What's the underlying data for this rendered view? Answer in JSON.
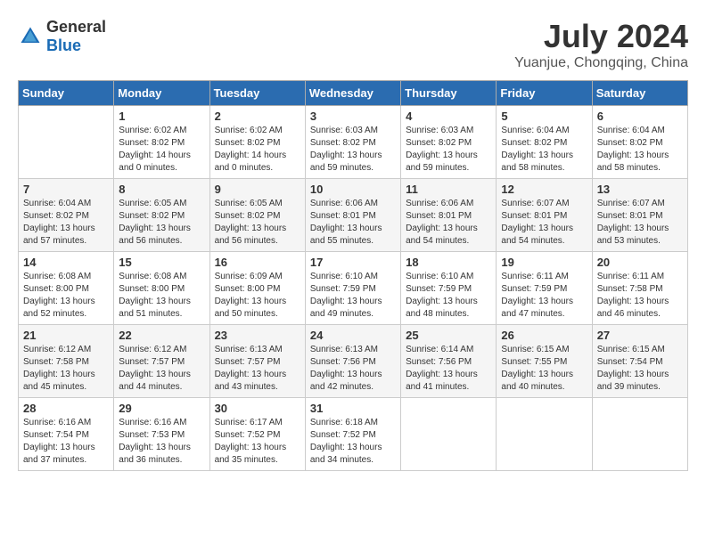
{
  "header": {
    "logo": {
      "general": "General",
      "blue": "Blue"
    },
    "title": "July 2024",
    "location": "Yuanjue, Chongqing, China"
  },
  "columns": [
    "Sunday",
    "Monday",
    "Tuesday",
    "Wednesday",
    "Thursday",
    "Friday",
    "Saturday"
  ],
  "weeks": [
    [
      {
        "day": "",
        "sunrise": "",
        "sunset": "",
        "daylight": ""
      },
      {
        "day": "1",
        "sunrise": "Sunrise: 6:02 AM",
        "sunset": "Sunset: 8:02 PM",
        "daylight": "Daylight: 14 hours and 0 minutes."
      },
      {
        "day": "2",
        "sunrise": "Sunrise: 6:02 AM",
        "sunset": "Sunset: 8:02 PM",
        "daylight": "Daylight: 14 hours and 0 minutes."
      },
      {
        "day": "3",
        "sunrise": "Sunrise: 6:03 AM",
        "sunset": "Sunset: 8:02 PM",
        "daylight": "Daylight: 13 hours and 59 minutes."
      },
      {
        "day": "4",
        "sunrise": "Sunrise: 6:03 AM",
        "sunset": "Sunset: 8:02 PM",
        "daylight": "Daylight: 13 hours and 59 minutes."
      },
      {
        "day": "5",
        "sunrise": "Sunrise: 6:04 AM",
        "sunset": "Sunset: 8:02 PM",
        "daylight": "Daylight: 13 hours and 58 minutes."
      },
      {
        "day": "6",
        "sunrise": "Sunrise: 6:04 AM",
        "sunset": "Sunset: 8:02 PM",
        "daylight": "Daylight: 13 hours and 58 minutes."
      }
    ],
    [
      {
        "day": "7",
        "sunrise": "Sunrise: 6:04 AM",
        "sunset": "Sunset: 8:02 PM",
        "daylight": "Daylight: 13 hours and 57 minutes."
      },
      {
        "day": "8",
        "sunrise": "Sunrise: 6:05 AM",
        "sunset": "Sunset: 8:02 PM",
        "daylight": "Daylight: 13 hours and 56 minutes."
      },
      {
        "day": "9",
        "sunrise": "Sunrise: 6:05 AM",
        "sunset": "Sunset: 8:02 PM",
        "daylight": "Daylight: 13 hours and 56 minutes."
      },
      {
        "day": "10",
        "sunrise": "Sunrise: 6:06 AM",
        "sunset": "Sunset: 8:01 PM",
        "daylight": "Daylight: 13 hours and 55 minutes."
      },
      {
        "day": "11",
        "sunrise": "Sunrise: 6:06 AM",
        "sunset": "Sunset: 8:01 PM",
        "daylight": "Daylight: 13 hours and 54 minutes."
      },
      {
        "day": "12",
        "sunrise": "Sunrise: 6:07 AM",
        "sunset": "Sunset: 8:01 PM",
        "daylight": "Daylight: 13 hours and 54 minutes."
      },
      {
        "day": "13",
        "sunrise": "Sunrise: 6:07 AM",
        "sunset": "Sunset: 8:01 PM",
        "daylight": "Daylight: 13 hours and 53 minutes."
      }
    ],
    [
      {
        "day": "14",
        "sunrise": "Sunrise: 6:08 AM",
        "sunset": "Sunset: 8:00 PM",
        "daylight": "Daylight: 13 hours and 52 minutes."
      },
      {
        "day": "15",
        "sunrise": "Sunrise: 6:08 AM",
        "sunset": "Sunset: 8:00 PM",
        "daylight": "Daylight: 13 hours and 51 minutes."
      },
      {
        "day": "16",
        "sunrise": "Sunrise: 6:09 AM",
        "sunset": "Sunset: 8:00 PM",
        "daylight": "Daylight: 13 hours and 50 minutes."
      },
      {
        "day": "17",
        "sunrise": "Sunrise: 6:10 AM",
        "sunset": "Sunset: 7:59 PM",
        "daylight": "Daylight: 13 hours and 49 minutes."
      },
      {
        "day": "18",
        "sunrise": "Sunrise: 6:10 AM",
        "sunset": "Sunset: 7:59 PM",
        "daylight": "Daylight: 13 hours and 48 minutes."
      },
      {
        "day": "19",
        "sunrise": "Sunrise: 6:11 AM",
        "sunset": "Sunset: 7:59 PM",
        "daylight": "Daylight: 13 hours and 47 minutes."
      },
      {
        "day": "20",
        "sunrise": "Sunrise: 6:11 AM",
        "sunset": "Sunset: 7:58 PM",
        "daylight": "Daylight: 13 hours and 46 minutes."
      }
    ],
    [
      {
        "day": "21",
        "sunrise": "Sunrise: 6:12 AM",
        "sunset": "Sunset: 7:58 PM",
        "daylight": "Daylight: 13 hours and 45 minutes."
      },
      {
        "day": "22",
        "sunrise": "Sunrise: 6:12 AM",
        "sunset": "Sunset: 7:57 PM",
        "daylight": "Daylight: 13 hours and 44 minutes."
      },
      {
        "day": "23",
        "sunrise": "Sunrise: 6:13 AM",
        "sunset": "Sunset: 7:57 PM",
        "daylight": "Daylight: 13 hours and 43 minutes."
      },
      {
        "day": "24",
        "sunrise": "Sunrise: 6:13 AM",
        "sunset": "Sunset: 7:56 PM",
        "daylight": "Daylight: 13 hours and 42 minutes."
      },
      {
        "day": "25",
        "sunrise": "Sunrise: 6:14 AM",
        "sunset": "Sunset: 7:56 PM",
        "daylight": "Daylight: 13 hours and 41 minutes."
      },
      {
        "day": "26",
        "sunrise": "Sunrise: 6:15 AM",
        "sunset": "Sunset: 7:55 PM",
        "daylight": "Daylight: 13 hours and 40 minutes."
      },
      {
        "day": "27",
        "sunrise": "Sunrise: 6:15 AM",
        "sunset": "Sunset: 7:54 PM",
        "daylight": "Daylight: 13 hours and 39 minutes."
      }
    ],
    [
      {
        "day": "28",
        "sunrise": "Sunrise: 6:16 AM",
        "sunset": "Sunset: 7:54 PM",
        "daylight": "Daylight: 13 hours and 37 minutes."
      },
      {
        "day": "29",
        "sunrise": "Sunrise: 6:16 AM",
        "sunset": "Sunset: 7:53 PM",
        "daylight": "Daylight: 13 hours and 36 minutes."
      },
      {
        "day": "30",
        "sunrise": "Sunrise: 6:17 AM",
        "sunset": "Sunset: 7:52 PM",
        "daylight": "Daylight: 13 hours and 35 minutes."
      },
      {
        "day": "31",
        "sunrise": "Sunrise: 6:18 AM",
        "sunset": "Sunset: 7:52 PM",
        "daylight": "Daylight: 13 hours and 34 minutes."
      },
      {
        "day": "",
        "sunrise": "",
        "sunset": "",
        "daylight": ""
      },
      {
        "day": "",
        "sunrise": "",
        "sunset": "",
        "daylight": ""
      },
      {
        "day": "",
        "sunrise": "",
        "sunset": "",
        "daylight": ""
      }
    ]
  ]
}
